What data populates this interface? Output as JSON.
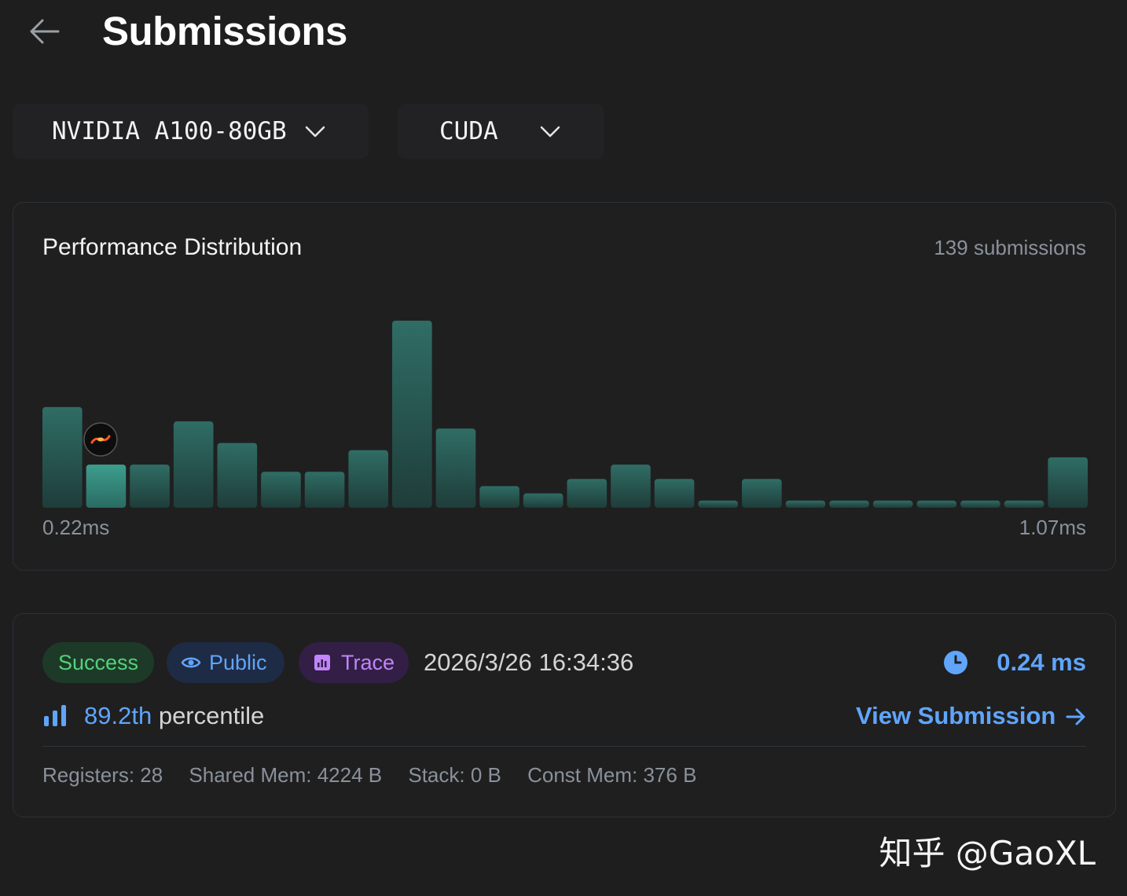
{
  "header": {
    "title": "Submissions"
  },
  "filters": {
    "gpu": "NVIDIA A100-80GB",
    "language": "CUDA"
  },
  "distribution": {
    "title": "Performance Distribution",
    "count_label": "139 submissions",
    "min_label": "0.22ms",
    "max_label": "1.07ms",
    "bar_color": "#2d6b63",
    "highlight_color": "#3a9b8b"
  },
  "chart_data": {
    "type": "bar",
    "title": "Performance Distribution",
    "xlabel": "",
    "ylabel": "",
    "x_range_ms": [
      0.22,
      1.07
    ],
    "values": [
      14,
      6,
      6,
      12,
      9,
      5,
      5,
      8,
      26,
      11,
      3,
      2,
      4,
      6,
      4,
      1,
      4,
      1,
      1,
      1,
      1,
      1,
      1,
      7
    ],
    "highlight_index": 1
  },
  "submission": {
    "status": "Success",
    "visibility": "Public",
    "trace": "Trace",
    "datetime": "2026/3/26 16:34:36",
    "time": "0.24 ms",
    "percentile_value": "89.2th",
    "percentile_suffix": "percentile",
    "view_link": "View Submission",
    "registers": "Registers: 28",
    "shared_mem": "Shared Mem: 4224 B",
    "stack": "Stack: 0 B",
    "const_mem": "Const Mem: 376 B"
  },
  "watermark": "知乎 @GaoXL"
}
